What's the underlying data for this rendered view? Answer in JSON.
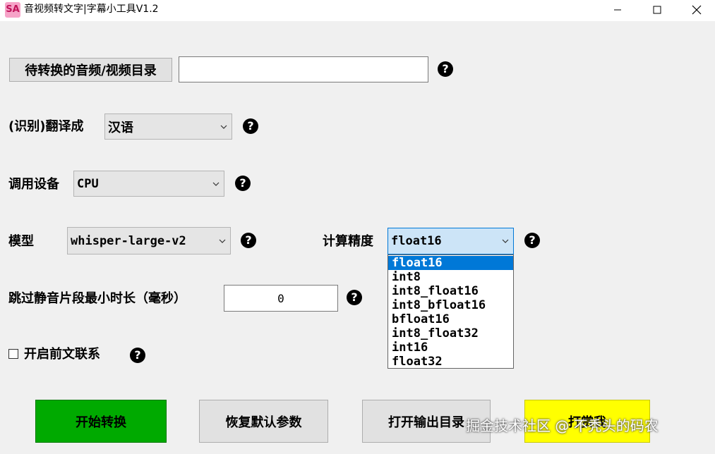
{
  "window": {
    "title": "音视频转文字|字幕小工具V1.2",
    "icon_text": "SA",
    "controls": [
      "minimize-icon",
      "maximize-icon",
      "close-icon"
    ]
  },
  "form": {
    "source_dir": {
      "button_label": "待转换的音频/视频目录",
      "value": ""
    },
    "translate": {
      "label": "(识别)翻译成",
      "selected": "汉语"
    },
    "device": {
      "label": "调用设备",
      "selected": "CPU"
    },
    "model": {
      "label": "模型",
      "selected": "whisper-large-v2"
    },
    "precision": {
      "label": "计算精度",
      "selected": "float16",
      "options": [
        "float16",
        "int8",
        "int8_float16",
        "int8_bfloat16",
        "bfloat16",
        "int8_float32",
        "int16",
        "float32"
      ],
      "expanded": true
    },
    "silence": {
      "label": "跳过静音片段最小时长（毫秒）",
      "value": "0"
    },
    "context": {
      "label": "开启前文联系",
      "checked": false
    },
    "help_glyph": "?"
  },
  "actions": {
    "start": "开始转换",
    "reset": "恢复默认参数",
    "open_output": "打开输出目录",
    "tip": "打赏我"
  },
  "watermark": "掘金技术社区 @ 不秃头的码农",
  "colors": {
    "start_button": "#00aa00",
    "tip_button": "#ffff00",
    "selection": "#0078d7",
    "active_combo": "#cce4f7"
  }
}
